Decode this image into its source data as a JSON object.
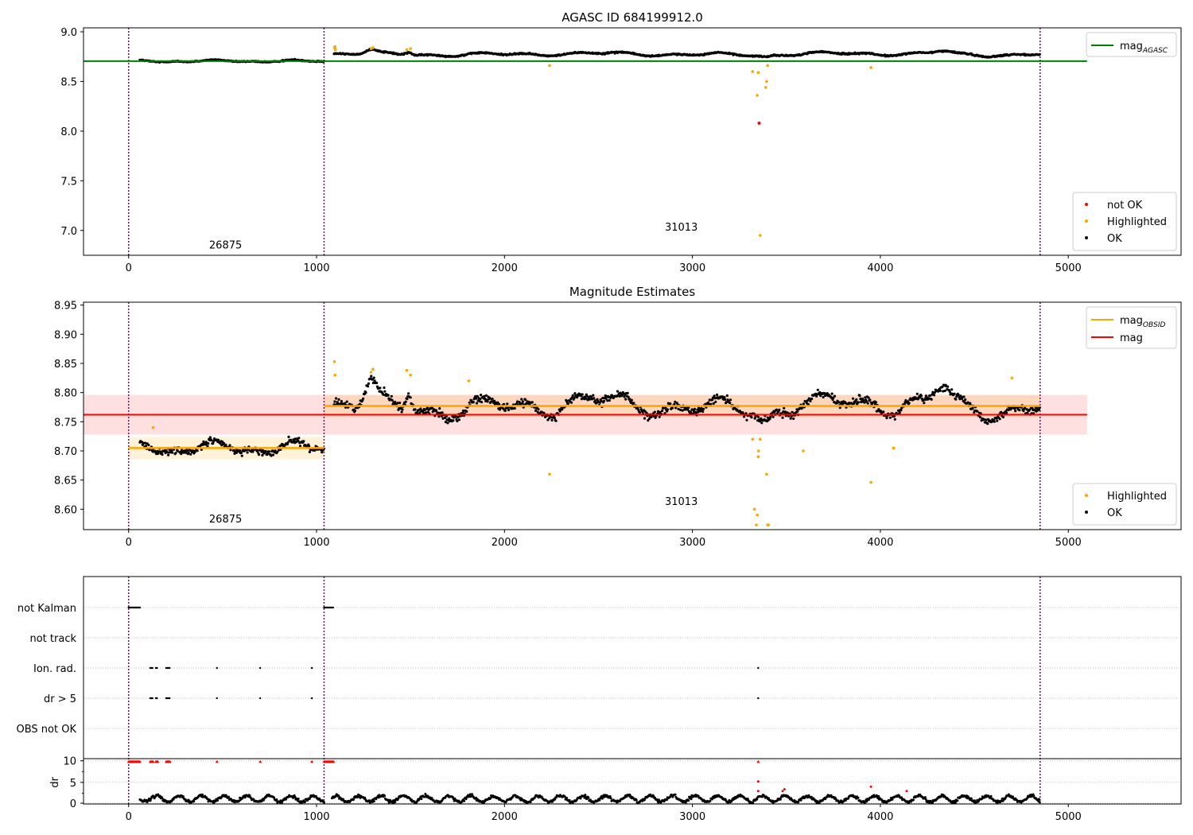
{
  "figure": {
    "suptitle": "AGASC ID 684199912.0"
  },
  "chart_data": [
    {
      "type": "scatter",
      "title": "AGASC ID 684199912.0",
      "xlim": [
        -240,
        5600
      ],
      "ylim": [
        6.75,
        9.04
      ],
      "xticks": [
        0,
        1000,
        2000,
        3000,
        4000,
        5000
      ],
      "yticks": [
        7.0,
        7.5,
        8.0,
        8.5,
        9.0
      ],
      "observations": [
        {
          "obsid": "26875",
          "start": 0,
          "end": 1040,
          "mean": 8.705,
          "label_pos": [
            520,
            6.82
          ]
        },
        {
          "obsid": "31013",
          "start": 1040,
          "end": 4850,
          "mean": 8.775,
          "label_pos": [
            2945,
            7.0
          ]
        }
      ],
      "reference_lines": [
        {
          "name": "mag_AGASC",
          "value": 8.705,
          "color": "#008000",
          "xrange": [
            -240,
            5100
          ]
        }
      ],
      "highlighted_points": [
        [
          1095,
          8.84
        ],
        [
          1098,
          8.85
        ],
        [
          1100,
          8.82
        ],
        [
          1290,
          8.83
        ],
        [
          1300,
          8.84
        ],
        [
          1480,
          8.82
        ],
        [
          1500,
          8.83
        ],
        [
          2240,
          8.66
        ],
        [
          3320,
          8.6
        ],
        [
          3350,
          8.59
        ],
        [
          3345,
          8.36
        ],
        [
          3360,
          6.95
        ],
        [
          3390,
          8.44
        ],
        [
          3395,
          8.5
        ],
        [
          3400,
          8.66
        ],
        [
          3950,
          8.64
        ]
      ],
      "not_ok_points": [
        [
          3355,
          8.08
        ]
      ],
      "legend_lines": [
        {
          "label": "mag",
          "sub": "AGASC",
          "color": "#008000"
        }
      ],
      "legend_points": [
        {
          "label": "not OK",
          "color": "#ff0000"
        },
        {
          "label": "Highlighted",
          "color": "#ffa500"
        },
        {
          "label": "OK",
          "color": "#000000"
        }
      ],
      "colors": {
        "ok": "#000000",
        "highlighted": "#ffa500",
        "not_ok": "#ff0000",
        "obs_boundary": "#800080"
      }
    },
    {
      "type": "scatter",
      "title": "Magnitude Estimates",
      "xlim": [
        -240,
        5600
      ],
      "ylim": [
        8.565,
        8.955
      ],
      "xticks": [
        0,
        1000,
        2000,
        3000,
        4000,
        5000
      ],
      "yticks": [
        8.6,
        8.65,
        8.7,
        8.75,
        8.8,
        8.85,
        8.9,
        8.95
      ],
      "observations": [
        {
          "obsid": "26875",
          "start": 0,
          "end": 1040,
          "mean": 8.705,
          "label_pos": [
            520,
            8.577
          ]
        },
        {
          "obsid": "31013",
          "start": 1040,
          "end": 4850,
          "mean": 8.777,
          "label_pos": [
            2945,
            8.607
          ]
        }
      ],
      "mag": {
        "value": 8.762,
        "low": 8.728,
        "high": 8.796,
        "xrange": [
          -240,
          5100
        ],
        "color": "#ff0000"
      },
      "highlighted_points": [
        [
          130,
          8.74
        ],
        [
          1095,
          8.853
        ],
        [
          1098,
          8.83
        ],
        [
          1290,
          8.835
        ],
        [
          1300,
          8.84
        ],
        [
          1480,
          8.838
        ],
        [
          1500,
          8.83
        ],
        [
          1810,
          8.82
        ],
        [
          2240,
          8.66
        ],
        [
          3320,
          8.72
        ],
        [
          3330,
          8.6
        ],
        [
          3340,
          8.573
        ],
        [
          3345,
          8.59
        ],
        [
          3350,
          8.69
        ],
        [
          3352,
          8.7
        ],
        [
          3360,
          8.72
        ],
        [
          3395,
          8.66
        ],
        [
          3400,
          8.573
        ],
        [
          3405,
          8.573
        ],
        [
          3590,
          8.7
        ],
        [
          3950,
          8.646
        ],
        [
          4070,
          8.705
        ],
        [
          4700,
          8.825
        ]
      ],
      "legend_lines": [
        {
          "label": "mag",
          "sub": "OBSID",
          "color": "#ffa500"
        },
        {
          "label": "mag",
          "sub": "",
          "color": "#ff0000"
        }
      ],
      "legend_points": [
        {
          "label": "Highlighted",
          "color": "#ffa500"
        },
        {
          "label": "OK",
          "color": "#000000"
        }
      ],
      "colors": {
        "ok": "#000000",
        "highlighted": "#ffa500",
        "obsid_band": "#ffa500",
        "mag_band": "#ff0000"
      }
    },
    {
      "type": "scatter",
      "title": "",
      "xlim": [
        -240,
        5600
      ],
      "xticks": [
        0,
        1000,
        2000,
        3000,
        4000,
        5000
      ],
      "flag_categories": [
        "not Kalman",
        "not track",
        "Ion. rad.",
        "dr > 5",
        "OBS not OK"
      ],
      "flag_points": {
        "not Kalman": [
          [
            0,
            60
          ],
          [
            1040,
            1090
          ]
        ],
        "not track": [],
        "Ion. rad.": [
          [
            115,
            130
          ],
          [
            145,
            155
          ],
          [
            200,
            220
          ],
          [
            470,
            470
          ],
          [
            700,
            700
          ],
          [
            975,
            975
          ],
          [
            3350,
            3350
          ]
        ],
        "dr > 5": [
          [
            115,
            130
          ],
          [
            145,
            155
          ],
          [
            200,
            220
          ],
          [
            470,
            470
          ],
          [
            700,
            700
          ],
          [
            975,
            975
          ],
          [
            3350,
            3350
          ]
        ],
        "OBS not OK": []
      },
      "dr": {
        "ylabel": "dr",
        "ylim": [
          0,
          10.5
        ],
        "yticks": [
          0,
          5,
          10
        ],
        "ceiling_points": [
          [
            0,
            60
          ],
          [
            115,
            130
          ],
          [
            145,
            155
          ],
          [
            200,
            220
          ],
          [
            470,
            470
          ],
          [
            700,
            700
          ],
          [
            975,
            975
          ],
          [
            1040,
            1090
          ],
          [
            3350,
            3350
          ]
        ],
        "outliers": [
          [
            3350,
            5.2
          ],
          [
            3350,
            3.0
          ],
          [
            3480,
            3.0
          ],
          [
            3490,
            3.4
          ],
          [
            3950,
            4.0
          ],
          [
            4140,
            3.0
          ]
        ]
      }
    }
  ]
}
